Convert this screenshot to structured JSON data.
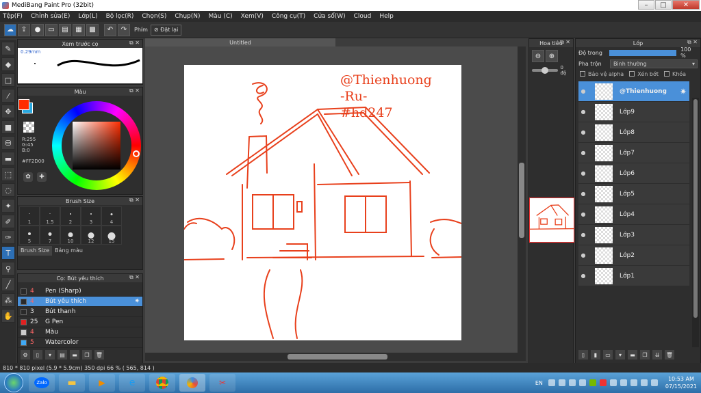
{
  "window": {
    "title": "MediBang Paint Pro (32bit)",
    "min": "–",
    "max": "□",
    "close": "✕"
  },
  "menu": [
    "Tệp(F)",
    "Chỉnh sửa(E)",
    "Lớp(L)",
    "Bộ lọc(R)",
    "Chọn(S)",
    "Chụp(N)",
    "Màu (C)",
    "Xem(V)",
    "Công cụ(T)",
    "Cửa sổ(W)",
    "Cloud",
    "Help"
  ],
  "toolbar": {
    "shortcut_label": "Phím",
    "reset_label": "Đặt lại"
  },
  "panels": {
    "brush_preview": {
      "title": "Xem trước cọ",
      "size": "0.29mm"
    },
    "color": {
      "title": "Màu",
      "r": "R:255",
      "g": "G:45",
      "b": "B:0",
      "hex": "#FF2D00",
      "primary": "#ff2d00",
      "secondary": "#29a8e0"
    },
    "brush_size": {
      "title": "Brush Size",
      "sizes": [
        "1",
        "1.5",
        "2",
        "3",
        "4",
        "5",
        "7",
        "10",
        "12",
        "15"
      ],
      "tab1": "Brush Size",
      "tab2": "Bảng màu"
    },
    "brush_list": {
      "title": "Cọ: Bút yêu thích",
      "items": [
        {
          "size": "4",
          "name": "Pen (Sharp)",
          "color": "#2a2a2a"
        },
        {
          "size": "4",
          "name": "Bút yêu thích",
          "color": "#2a2a2a"
        },
        {
          "size": "3",
          "name": "Bút thanh",
          "color": "#2a2a2a"
        },
        {
          "size": "25",
          "name": "G Pen",
          "color": "#e02020"
        },
        {
          "size": "4",
          "name": "Màu",
          "color": "#cccccc"
        },
        {
          "size": "5",
          "name": "Watercolor",
          "color": "#3fa9f5"
        }
      ]
    }
  },
  "document": {
    "tab": "Untitled"
  },
  "canvas_text": [
    "@Thienhuong",
    "-Ru-",
    "#hd247"
  ],
  "navigator": {
    "title": "Hoa tiêu",
    "angle": "0 độ"
  },
  "layers": {
    "title": "Lớp",
    "opacity_label": "Độ trong",
    "opacity_value": "100 %",
    "blend_label": "Pha trộn",
    "blend_value": "Bình thường",
    "protect_alpha": "Bảo vệ alpha",
    "clipping": "Xén bớt",
    "lock": "Khóa",
    "items": [
      {
        "name": "@Thienhuong",
        "selected": true
      },
      {
        "name": "Lớp9"
      },
      {
        "name": "Lớp8"
      },
      {
        "name": "Lớp7"
      },
      {
        "name": "Lớp6"
      },
      {
        "name": "Lớp5"
      },
      {
        "name": "Lớp4"
      },
      {
        "name": "Lớp3"
      },
      {
        "name": "Lớp2"
      },
      {
        "name": "Lớp1"
      }
    ]
  },
  "status": {
    "text": "810 * 810 pixel  (5.9 * 5.9cm)  350 dpi  66 %  ( 565, 814 )"
  },
  "taskbar": {
    "app1": "Zalo",
    "lang": "EN",
    "time": "10:53 AM",
    "date": "07/15/2021"
  },
  "colors": {
    "stroke": "#e8401c",
    "accent": "#4a90d9"
  }
}
